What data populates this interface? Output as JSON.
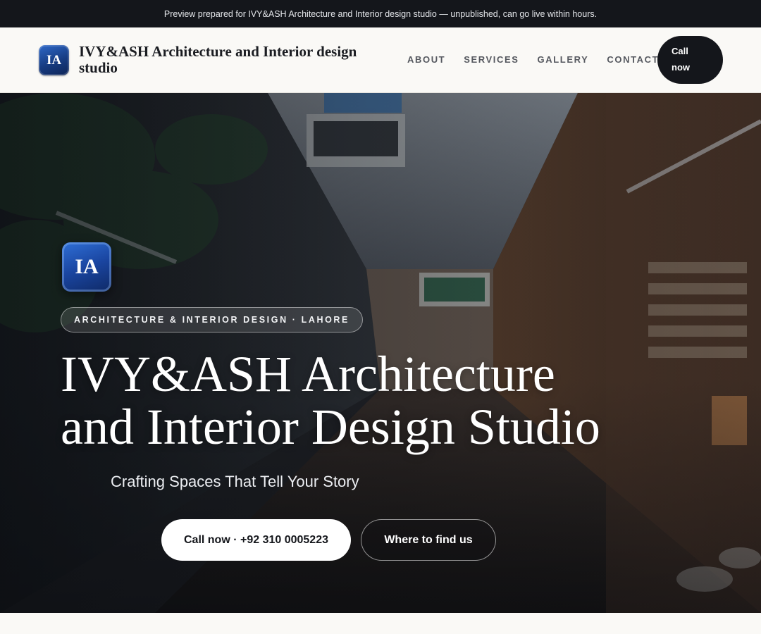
{
  "preview_banner": "Preview prepared for IVY&ASH Architecture and Interior design studio — unpublished, can go live within hours.",
  "header": {
    "logo_text": "IA",
    "site_title": "IVY&ASH Architecture and Interior design studio",
    "nav": [
      "ABOUT",
      "SERVICES",
      "GALLERY",
      "CONTACT"
    ],
    "call_button": "Call now"
  },
  "hero": {
    "logo_text": "IA",
    "badge": "ARCHITECTURE & INTERIOR DESIGN · LAHORE",
    "title": "IVY&ASH Architecture and Interior Design Studio",
    "subtitle": "Crafting Spaces That Tell Your Story",
    "primary_button": "Call now · +92 310 0005223",
    "secondary_button": "Where to find us"
  },
  "colors": {
    "dark": "#14161b",
    "page_bg": "#faf9f6",
    "brand_blue": "#1a45a0"
  },
  "icons": {
    "background": "market-alley-photo"
  }
}
